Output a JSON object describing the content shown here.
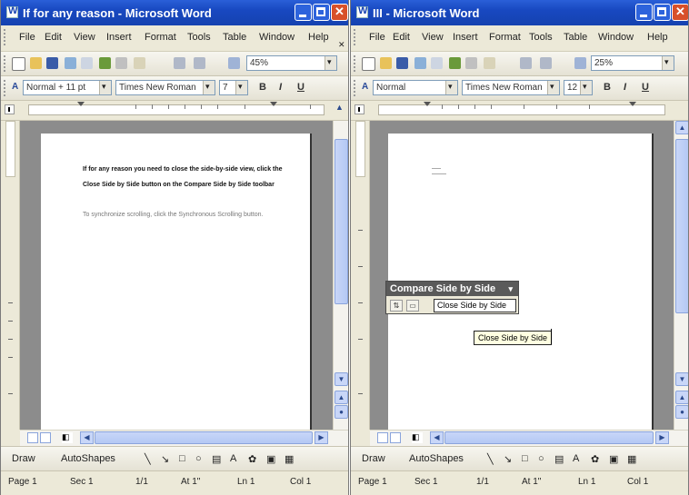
{
  "left_window": {
    "title": "If for any reason - Microsoft Word",
    "menu": [
      "File",
      "Edit",
      "View",
      "Insert",
      "Format",
      "Tools",
      "Table",
      "Window",
      "Help"
    ],
    "zoom": "45%",
    "style": "Normal + 11 pt",
    "font": "Times New Roman",
    "font_size": "7",
    "format_buttons": [
      "B",
      "I",
      "U"
    ],
    "doc_bold_text": "If for any reason you need to close the side-by-side view, click the",
    "doc_bold_text_2": "Close Side by Side button on the Compare Side by Side toolbar",
    "doc_body_text": "To synchronize scrolling, click the Synchronous Scrolling button.",
    "draw_label": "Draw",
    "autoshapes_label": "AutoShapes",
    "status": {
      "page": "Page 1",
      "sec": "Sec 1",
      "pages": "1/1",
      "at": "At 1\"",
      "ln": "Ln 1",
      "col": "Col 1"
    }
  },
  "right_window": {
    "title": "III - Microsoft Word",
    "menu": [
      "File",
      "Edit",
      "View",
      "Insert",
      "Format",
      "Tools",
      "Table",
      "Window",
      "Help"
    ],
    "zoom": "25%",
    "style": "Normal",
    "font": "Times New Roman",
    "font_size": "12",
    "format_buttons": [
      "B",
      "I",
      "U"
    ],
    "draw_label": "Draw",
    "autoshapes_label": "AutoShapes",
    "status": {
      "page": "Page 1",
      "sec": "Sec 1",
      "pages": "1/1",
      "at": "At 1\"",
      "ln": "Ln 1",
      "col": "Col 1"
    }
  },
  "compare_toolbar": {
    "title": "Compare Side by Side",
    "close_button_label": "Close Side by Side"
  },
  "tooltip": {
    "text": "Close Side by Side"
  },
  "colors": {
    "titlebar": "#1848c0",
    "chrome": "#ece9d8",
    "doc_background": "#8c8c8c",
    "tooltip": "#ffffe1"
  }
}
